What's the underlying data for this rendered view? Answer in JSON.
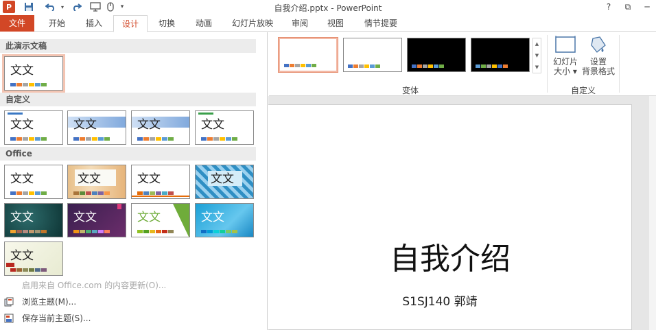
{
  "window": {
    "title": "自我介绍.pptx - PowerPoint",
    "app_icon": "P",
    "help": "?",
    "restore": "⧉",
    "minimize": "─"
  },
  "tabs": [
    "文件",
    "开始",
    "插入",
    "设计",
    "切换",
    "动画",
    "幻灯片放映",
    "审阅",
    "视图",
    "情节提要"
  ],
  "active_tab": "设计",
  "colors": {
    "accent": "#d24726",
    "swatches": [
      "#4472c4",
      "#ed7d31",
      "#a5a5a5",
      "#ffc000",
      "#5b9bd5",
      "#70ad47"
    ]
  },
  "ribbon": {
    "variants_label": "变体",
    "customize_label": "自定义",
    "slide_size": [
      "幻灯片",
      "大小 ▾"
    ],
    "format_bg": [
      "设置",
      "背景格式"
    ]
  },
  "theme_panel": {
    "this_presentation": "此演示文稿",
    "custom": "自定义",
    "office": "Office",
    "sample_text": "文文",
    "menu": {
      "enable_updates": "启用来自 Office.com 的内容更新(O)...",
      "browse": "浏览主题(M)...",
      "save": "保存当前主题(S)..."
    }
  },
  "slide": {
    "title": "自我介绍",
    "subtitle": "S1SJ140 郭靖"
  }
}
